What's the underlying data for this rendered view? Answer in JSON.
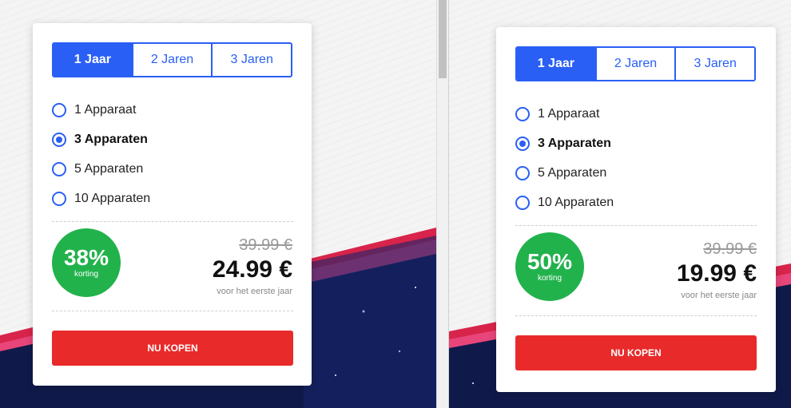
{
  "left": {
    "tabs": [
      {
        "label": "1 Jaar",
        "active": true
      },
      {
        "label": "2 Jaren",
        "active": false
      },
      {
        "label": "3 Jaren",
        "active": false
      }
    ],
    "options": [
      {
        "label": "1 Apparaat",
        "selected": false
      },
      {
        "label": "3 Apparaten",
        "selected": true
      },
      {
        "label": "5 Apparaten",
        "selected": false
      },
      {
        "label": "10 Apparaten",
        "selected": false
      }
    ],
    "discount": {
      "percent": "38%",
      "label": "korting"
    },
    "old_price": "39.99 €",
    "new_price": "24.99 €",
    "price_note": "voor het eerste jaar",
    "buy_label": "NU KOPEN"
  },
  "right": {
    "tabs": [
      {
        "label": "1 Jaar",
        "active": true
      },
      {
        "label": "2 Jaren",
        "active": false
      },
      {
        "label": "3 Jaren",
        "active": false
      }
    ],
    "options": [
      {
        "label": "1 Apparaat",
        "selected": false
      },
      {
        "label": "3 Apparaten",
        "selected": true
      },
      {
        "label": "5 Apparaten",
        "selected": false
      },
      {
        "label": "10 Apparaten",
        "selected": false
      }
    ],
    "discount": {
      "percent": "50%",
      "label": "korting"
    },
    "old_price": "39.99 €",
    "new_price": "19.99 €",
    "price_note": "voor het eerste jaar",
    "buy_label": "NU KOPEN"
  },
  "colors": {
    "accent_blue": "#2a5ff5",
    "discount_green": "#22b24c",
    "buy_red": "#e82a2a",
    "banner_pink": "#e8457a",
    "banner_navy": "#101a4a"
  }
}
